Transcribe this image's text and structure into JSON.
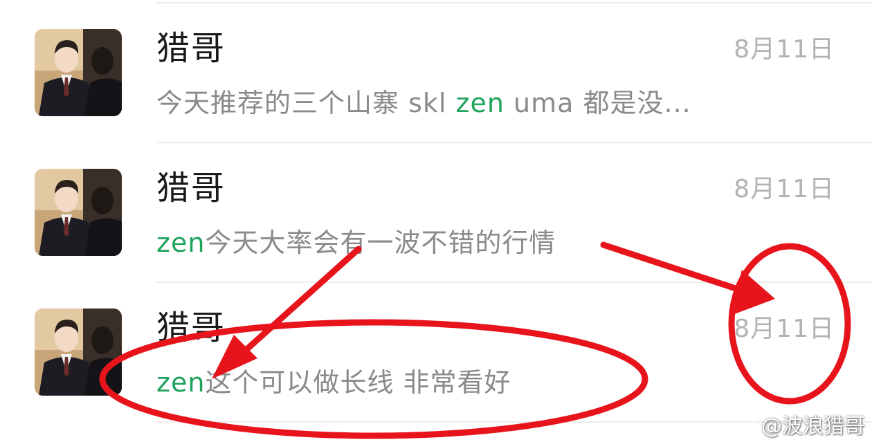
{
  "chats": [
    {
      "name": "猎哥",
      "time": "8月11日",
      "preview_pre": "今天推荐的三个山寨 skl ",
      "preview_hl": "zen",
      "preview_post": "  uma 都是没..."
    },
    {
      "name": "猎哥",
      "time": "8月11日",
      "preview_pre": "",
      "preview_hl": "zen",
      "preview_post": "今天大率会有一波不错的行情"
    },
    {
      "name": "猎哥",
      "time": "8月11日",
      "preview_pre": "",
      "preview_hl": "zen",
      "preview_post": "这个可以做长线  非常看好"
    }
  ],
  "watermark": {
    "text": "@波浪猎哥",
    "icon": "weibo-icon"
  },
  "colors": {
    "highlight": "#1fa35d",
    "annotation": "#e8141c",
    "time": "#b2b2b2",
    "preview": "#8a8a8a"
  }
}
